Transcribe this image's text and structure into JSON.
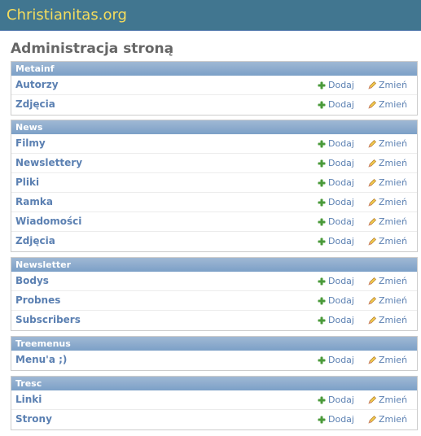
{
  "site": {
    "title": "Christianitas.org"
  },
  "page": {
    "title": "Administracja stroną"
  },
  "labels": {
    "add": "Dodaj",
    "change": "Zmień"
  },
  "icons": {
    "add": "plus-icon",
    "change": "pencil-icon"
  },
  "colors": {
    "header": "#417690",
    "site_title": "#f5dd5d",
    "link": "#5b80b2",
    "add_icon": "#4a9a3a",
    "caption": "#7ca0c7"
  },
  "modules": [
    {
      "caption": "Metainf",
      "rows": [
        "Autorzy",
        "Zdjęcia"
      ]
    },
    {
      "caption": "News",
      "rows": [
        "Filmy",
        "Newslettery",
        "Pliki",
        "Ramka",
        "Wiadomości",
        "Zdjęcia"
      ]
    },
    {
      "caption": "Newsletter",
      "rows": [
        "Bodys",
        "Probnes",
        "Subscribers"
      ]
    },
    {
      "caption": "Treemenus",
      "rows": [
        "Menu'a ;)"
      ]
    },
    {
      "caption": "Tresc",
      "rows": [
        "Linki",
        "Strony"
      ]
    }
  ]
}
